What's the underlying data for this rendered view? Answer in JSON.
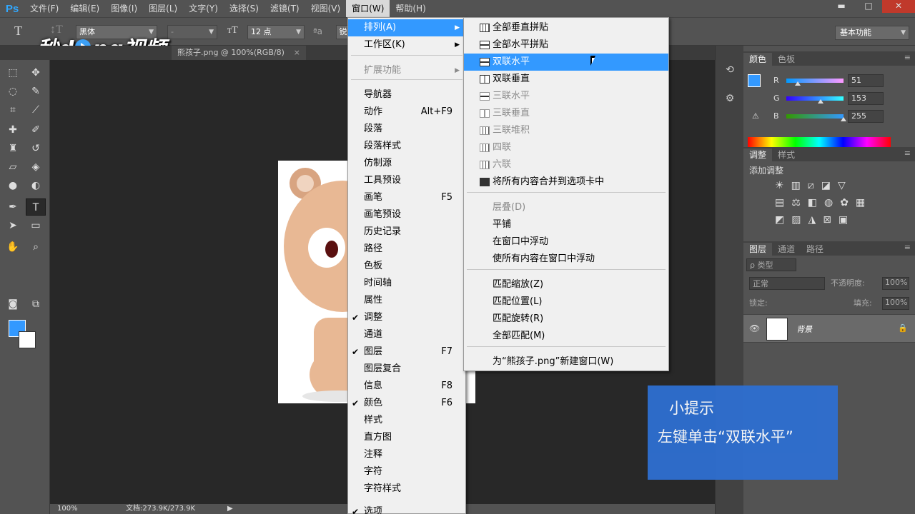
{
  "menubar": {
    "logo": "Ps",
    "items": [
      "文件(F)",
      "编辑(E)",
      "图像(I)",
      "图层(L)",
      "文字(Y)",
      "选择(S)",
      "滤镜(T)",
      "视图(V)",
      "窗口(W)",
      "帮助(H)"
    ],
    "active_index": 8
  },
  "window_controls": {
    "minimize": "▬",
    "maximize": "□",
    "close": "✕"
  },
  "options": {
    "font_family": "黑体",
    "font_style": "-",
    "font_size": "12 点",
    "aa_label": "ªa",
    "aa_value": "锐",
    "workspace": "基本功能"
  },
  "watermark": {
    "text_left": "秒d",
    "text_right": "ng视频"
  },
  "doc_tab": {
    "title": "熊孩子.png @ 100%(RGB/8)",
    "close": "×"
  },
  "status": {
    "zoom": "100%",
    "doc": "文档:273.9K/273.9K",
    "arrow": "▶"
  },
  "window_menu": {
    "items": [
      {
        "label": "排列(A)",
        "submenu": true,
        "highlight": true
      },
      {
        "label": "工作区(K)",
        "submenu": true
      },
      {
        "label": "扩展功能",
        "submenu": true,
        "disabled": true
      },
      {
        "label": "导航器"
      },
      {
        "label": "动作",
        "shortcut": "Alt+F9"
      },
      {
        "label": "段落"
      },
      {
        "label": "段落样式"
      },
      {
        "label": "仿制源"
      },
      {
        "label": "工具预设"
      },
      {
        "label": "画笔",
        "shortcut": "F5"
      },
      {
        "label": "画笔预设"
      },
      {
        "label": "历史记录"
      },
      {
        "label": "路径"
      },
      {
        "label": "色板"
      },
      {
        "label": "时间轴"
      },
      {
        "label": "属性"
      },
      {
        "label": "调整",
        "checked": true
      },
      {
        "label": "通道"
      },
      {
        "label": "图层",
        "checked": true,
        "shortcut": "F7"
      },
      {
        "label": "图层复合"
      },
      {
        "label": "信息",
        "shortcut": "F8"
      },
      {
        "label": "颜色",
        "checked": true,
        "shortcut": "F6"
      },
      {
        "label": "样式"
      },
      {
        "label": "直方图"
      },
      {
        "label": "注释"
      },
      {
        "label": "字符"
      },
      {
        "label": "字符样式"
      },
      {
        "label": "选项",
        "checked": true
      }
    ]
  },
  "arrange_submenu": {
    "items": [
      {
        "label": "全部垂直拼贴",
        "icon": "grid"
      },
      {
        "label": "全部水平拼贴",
        "icon": "hsplit"
      },
      {
        "label": "双联水平",
        "icon": "hsplit",
        "highlight": true
      },
      {
        "label": "双联垂直",
        "icon": "vsplit"
      },
      {
        "label": "三联水平",
        "icon": "hsplit",
        "disabled": true
      },
      {
        "label": "三联垂直",
        "icon": "vsplit",
        "disabled": true
      },
      {
        "label": "三联堆积",
        "icon": "grid",
        "disabled": true
      },
      {
        "label": "四联",
        "icon": "grid",
        "disabled": true
      },
      {
        "label": "六联",
        "icon": "grid",
        "disabled": true
      },
      {
        "label": "将所有内容合并到选项卡中",
        "icon": "filled"
      },
      {
        "label": "层叠(D)",
        "disabled": true
      },
      {
        "label": "平铺"
      },
      {
        "label": "在窗口中浮动"
      },
      {
        "label": "使所有内容在窗口中浮动"
      },
      {
        "label": "匹配缩放(Z)"
      },
      {
        "label": "匹配位置(L)"
      },
      {
        "label": "匹配旋转(R)"
      },
      {
        "label": "全部匹配(M)"
      },
      {
        "label": "为“熊孩子.png”新建窗口(W)"
      }
    ]
  },
  "color_panel": {
    "tabs": [
      "颜色",
      "色板"
    ],
    "r": "51",
    "g": "153",
    "b": "255",
    "r_label": "R",
    "g_label": "G",
    "b_label": "B",
    "warning": "⚠",
    "r_fraction": 0.2,
    "g_fraction": 0.6,
    "b_fraction": 1.0,
    "fg_color": "#3399ff"
  },
  "adjust_panel": {
    "tabs": [
      "调整",
      "样式"
    ],
    "title": "添加调整"
  },
  "layers_panel": {
    "tabs": [
      "图层",
      "通道",
      "路径"
    ],
    "filter_kind": "ρ 类型",
    "blend_mode": "正常",
    "opacity_label": "不透明度:",
    "opacity_value": "100%",
    "lock_label": "锁定:",
    "fill_label": "填充:",
    "fill_value": "100%",
    "layer_name": "背景"
  },
  "tip": {
    "title": "小提示",
    "text": "左键单击“双联水平”"
  }
}
